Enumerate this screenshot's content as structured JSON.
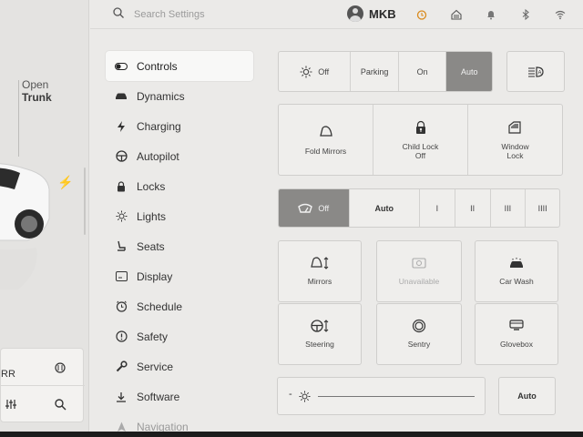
{
  "car": {
    "trunk_line1": "Open",
    "trunk_line2": "Trunk",
    "quick_label": "RR"
  },
  "topbar": {
    "search_placeholder": "Search Settings",
    "profile_name": "MKB"
  },
  "menu": {
    "items": [
      {
        "label": "Controls",
        "icon": "toggle-icon"
      },
      {
        "label": "Dynamics",
        "icon": "car-icon"
      },
      {
        "label": "Charging",
        "icon": "bolt-icon"
      },
      {
        "label": "Autopilot",
        "icon": "steering-wheel-icon"
      },
      {
        "label": "Locks",
        "icon": "lock-icon"
      },
      {
        "label": "Lights",
        "icon": "sun-icon"
      },
      {
        "label": "Seats",
        "icon": "seat-icon"
      },
      {
        "label": "Display",
        "icon": "display-icon"
      },
      {
        "label": "Schedule",
        "icon": "clock-icon"
      },
      {
        "label": "Safety",
        "icon": "info-icon"
      },
      {
        "label": "Service",
        "icon": "wrench-icon"
      },
      {
        "label": "Software",
        "icon": "download-icon"
      },
      {
        "label": "Navigation",
        "icon": "navigation-icon"
      }
    ]
  },
  "lights": {
    "options": [
      "Off",
      "Parking",
      "On",
      "Auto"
    ],
    "selected": "Auto"
  },
  "controls": {
    "fold_mirrors": "Fold Mirrors",
    "child_lock": "Child Lock",
    "child_lock_state": "Off",
    "window_lock_l1": "Window",
    "window_lock_l2": "Lock"
  },
  "wipers": {
    "options": [
      "Off",
      "Auto",
      "I",
      "II",
      "III",
      "IIII"
    ],
    "selected": "Off"
  },
  "adjust": {
    "mirrors": "Mirrors",
    "unavailable": "Unavailable",
    "car_wash": "Car Wash",
    "steering": "Steering",
    "sentry": "Sentry",
    "glovebox": "Glovebox"
  },
  "brightness": {
    "auto_label": "Auto",
    "level": 0.0
  },
  "colors": {
    "selected_segment": "#8a8987",
    "background": "#ebeae8"
  }
}
